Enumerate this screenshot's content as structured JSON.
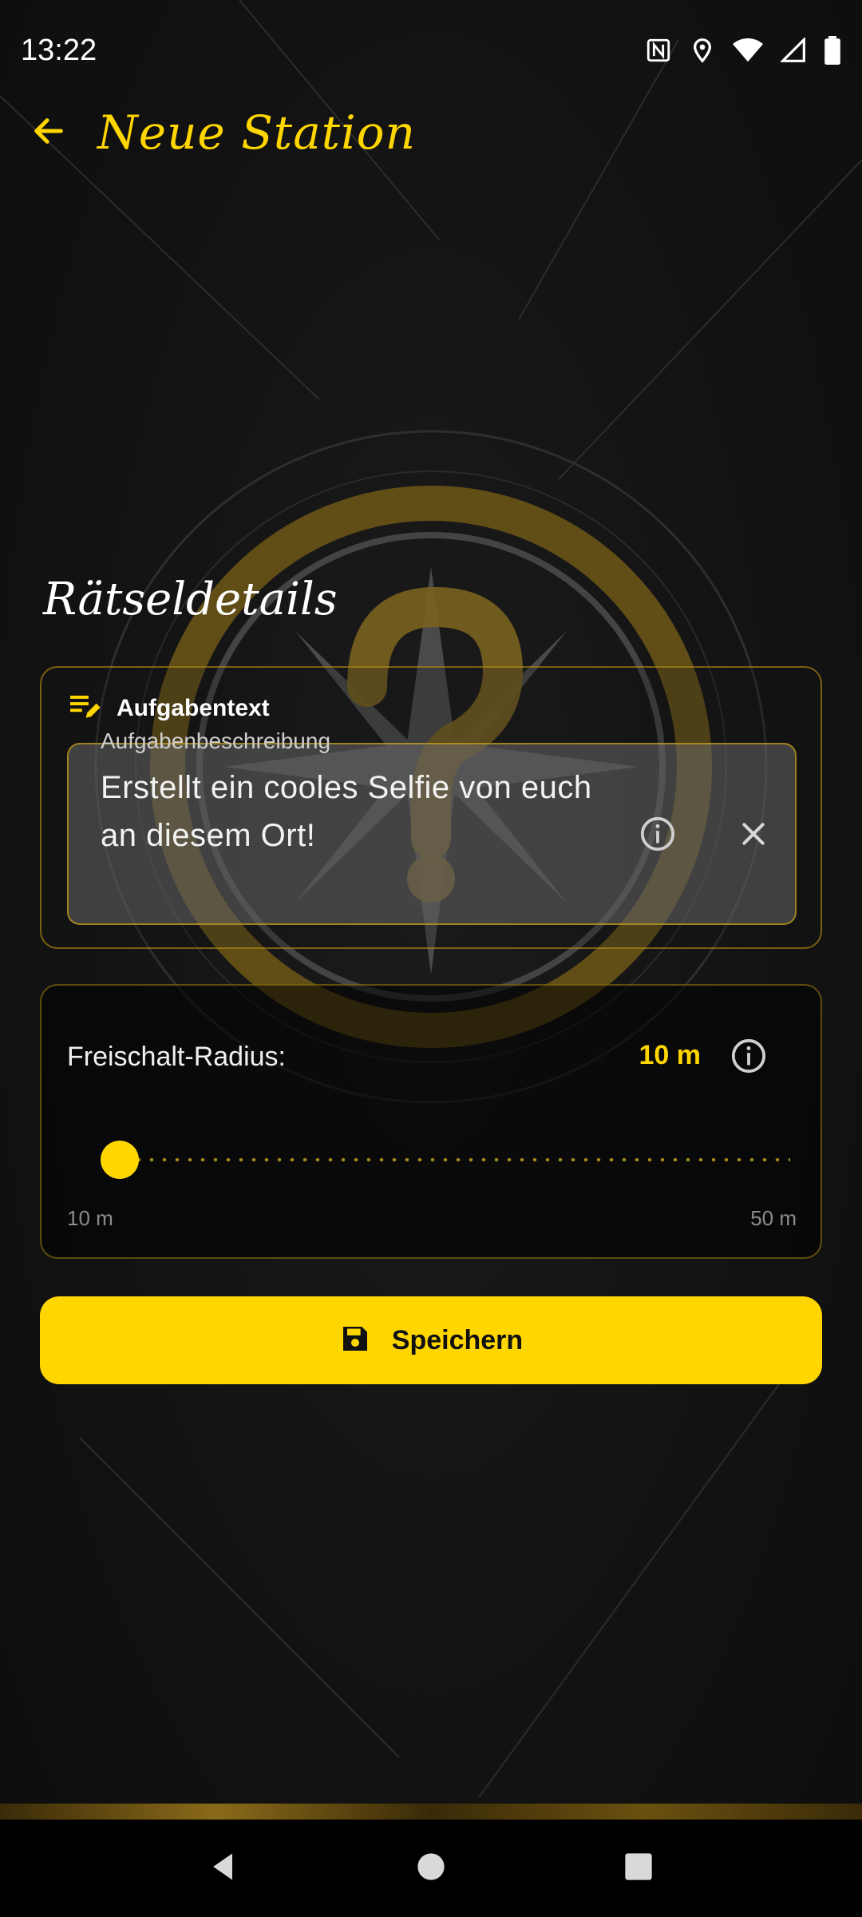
{
  "status_bar": {
    "time": "13:22",
    "icons": [
      "nfc-icon",
      "location-icon",
      "wifi-icon",
      "signal-icon",
      "battery-icon"
    ]
  },
  "app_bar": {
    "back_icon": "arrow-back-icon",
    "title": "Neue Station"
  },
  "section": {
    "title": "Rätseldetails"
  },
  "task": {
    "header_icon": "edit-note-icon",
    "header_label": "Aufgabentext",
    "field_label": "Aufgabenbeschreibung",
    "field_value": "Erstellt ein cooles Selfie von euch an diesem Ort!",
    "info_icon": "info-icon",
    "clear_icon": "close-icon"
  },
  "radius": {
    "label": "Freischalt-Radius:",
    "value_label": "10 m",
    "value": 10,
    "min": 10,
    "max": 50,
    "min_label": "10 m",
    "max_label": "50 m",
    "info_icon": "info-icon"
  },
  "save_button": {
    "icon": "save-icon",
    "label": "Speichern"
  },
  "colors": {
    "accent": "#ffd600",
    "background": "#121314",
    "border": "#c8a014"
  },
  "nav_bar": {
    "icons": [
      "nav-back-icon",
      "nav-home-icon",
      "nav-recents-icon"
    ]
  }
}
